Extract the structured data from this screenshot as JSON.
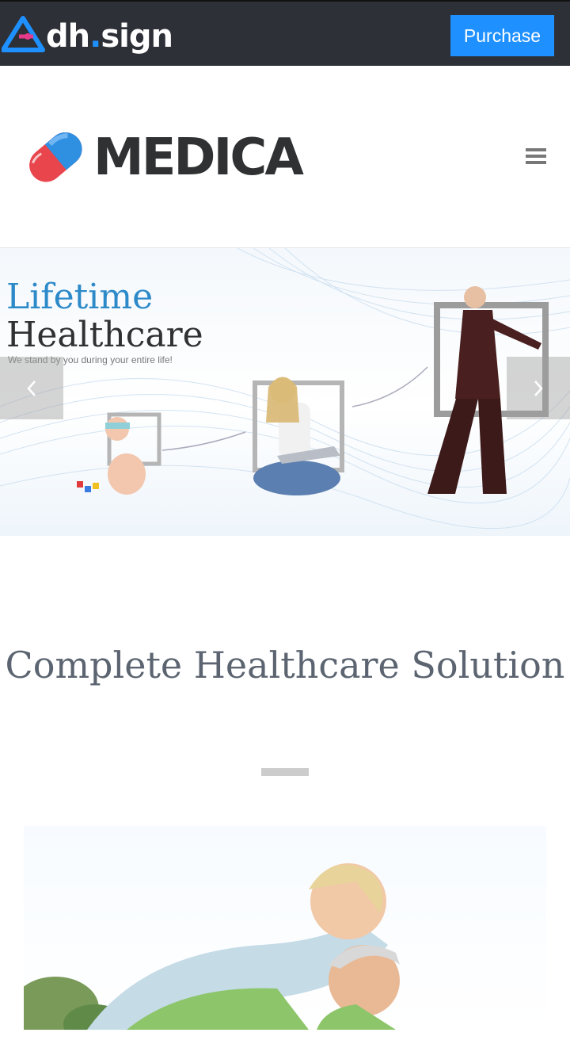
{
  "topbar": {
    "brand_main": "dh",
    "brand_dot": ".",
    "brand_rest": "sign",
    "purchase_label": "Purchase",
    "accent": "#1e90ff",
    "background": "#2d3037"
  },
  "header": {
    "logo_text": "MEDICA",
    "menu_icon": "hamburger-menu-icon"
  },
  "slider": {
    "title_line1": "Lifetime",
    "title_line2": "Healthcare",
    "subtitle": "We stand by you during your entire life!",
    "prev_icon": "chevron-left-icon",
    "next_icon": "chevron-right-icon",
    "title_color": "#2d8ac9"
  },
  "section": {
    "title": "Complete Healthcare Solution"
  }
}
